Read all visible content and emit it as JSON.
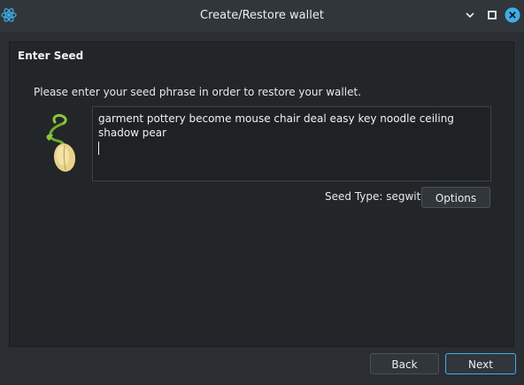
{
  "window": {
    "title": "Create/Restore wallet",
    "app_icon": "electrum-atom-icon",
    "controls": [
      "minimize-icon",
      "maximize-icon",
      "close-icon"
    ]
  },
  "page": {
    "heading": "Enter Seed",
    "instructions": "Please enter your seed phrase in order to restore your wallet.",
    "logo_icon": "sprouting-seed-icon"
  },
  "seed_input": {
    "value": "garment pottery become mouse chair deal easy key noodle ceiling shadow pear"
  },
  "seed_type": {
    "text": "Seed Type: segwit",
    "options_label": "Options"
  },
  "footer": {
    "back_label": "Back",
    "next_label": "Next"
  },
  "colors": {
    "window_bg": "#2a2e32",
    "panel_bg": "#232629",
    "accent": "#3daee9",
    "close_button": "#3daee9"
  }
}
